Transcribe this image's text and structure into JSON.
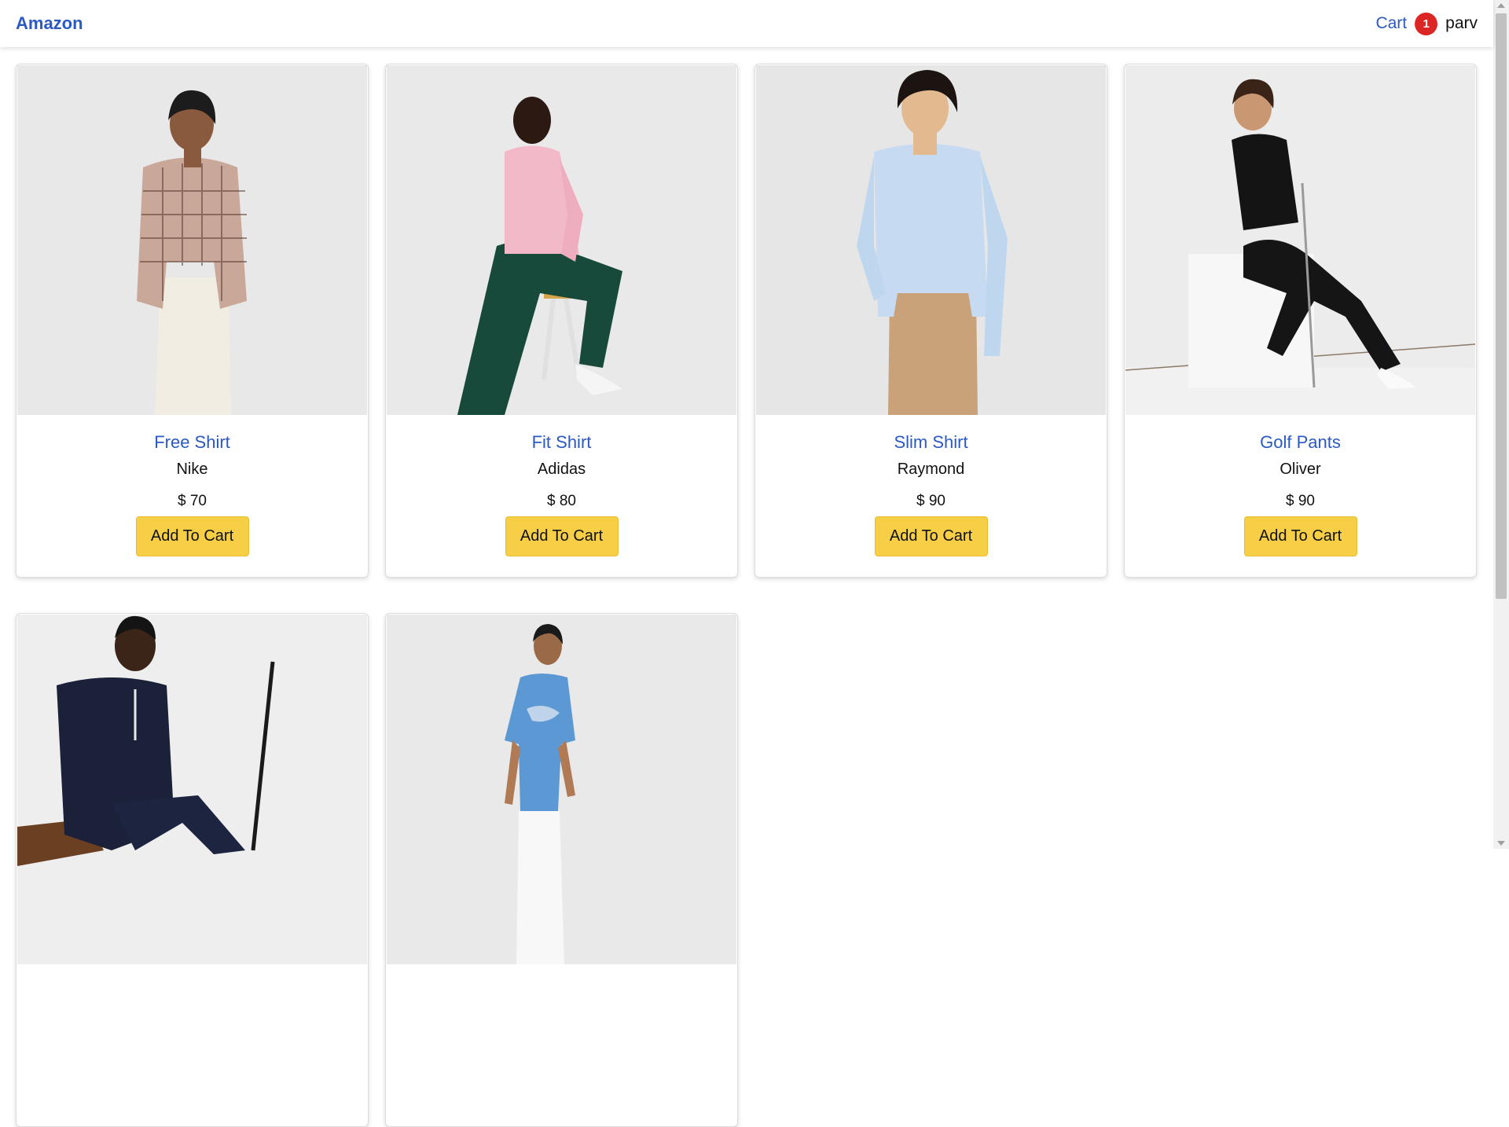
{
  "navbar": {
    "brand": "Amazon",
    "cart_label": "Cart",
    "cart_count": "1",
    "user": "parv"
  },
  "products": [
    {
      "name": "Free Shirt",
      "brand": "Nike",
      "price": "$ 70",
      "button": "Add To Cart",
      "image": "photo-man-plaid-shirt"
    },
    {
      "name": "Fit Shirt",
      "brand": "Adidas",
      "price": "$ 80",
      "button": "Add To Cart",
      "image": "photo-man-pink-shirt-seated"
    },
    {
      "name": "Slim Shirt",
      "brand": "Raymond",
      "price": "$ 90",
      "button": "Add To Cart",
      "image": "photo-man-light-blue-shirt"
    },
    {
      "name": "Golf Pants",
      "brand": "Oliver",
      "price": "$ 90",
      "button": "Add To Cart",
      "image": "photo-man-black-golf-outfit"
    },
    {
      "name": "",
      "brand": "",
      "price": "",
      "button": "",
      "image": "photo-man-navy-polo-seated"
    },
    {
      "name": "",
      "brand": "",
      "price": "",
      "button": "",
      "image": "photo-man-blue-tshirt"
    }
  ],
  "colors": {
    "link": "#2b59c3",
    "badge": "#dc2626",
    "button": "#f7cf47"
  }
}
